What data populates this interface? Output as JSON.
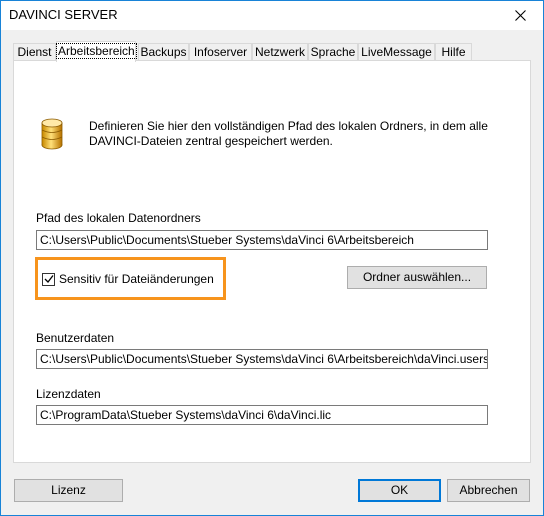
{
  "window": {
    "title": "DAVINCI SERVER"
  },
  "tabs": [
    {
      "label": "Dienst"
    },
    {
      "label": "Arbeitsbereich"
    },
    {
      "label": "Backups"
    },
    {
      "label": "Infoserver"
    },
    {
      "label": "Netzwerk"
    },
    {
      "label": "Sprache"
    },
    {
      "label": "LiveMessage"
    },
    {
      "label": "Hilfe"
    }
  ],
  "active_tab": "Arbeitsbereich",
  "panel": {
    "intro_text": "Definieren Sie hier den vollständigen Pfad des lokalen Ordners, in dem alle DAVINCI-Dateien zentral gespeichert werden.",
    "folder_label": "Pfad des lokalen Datenordners",
    "folder_value": "C:\\Users\\Public\\Documents\\Stueber Systems\\daVinci 6\\Arbeitsbereich",
    "sensitive_label": "Sensitiv für Dateiänderungen",
    "sensitive_checked": true,
    "choose_folder_label": "Ordner auswählen...",
    "userdata_label": "Benutzerdaten",
    "userdata_value": "C:\\Users\\Public\\Documents\\Stueber Systems\\daVinci 6\\Arbeitsbereich\\daVinci.users",
    "license_label": "Lizenzdaten",
    "license_value": "C:\\ProgramData\\Stueber Systems\\daVinci 6\\daVinci.lic"
  },
  "footer": {
    "license_button": "Lizenz",
    "ok_button": "OK",
    "cancel_button": "Abbrechen"
  },
  "colors": {
    "highlight": "#f7941d",
    "accent": "#0078d7"
  }
}
